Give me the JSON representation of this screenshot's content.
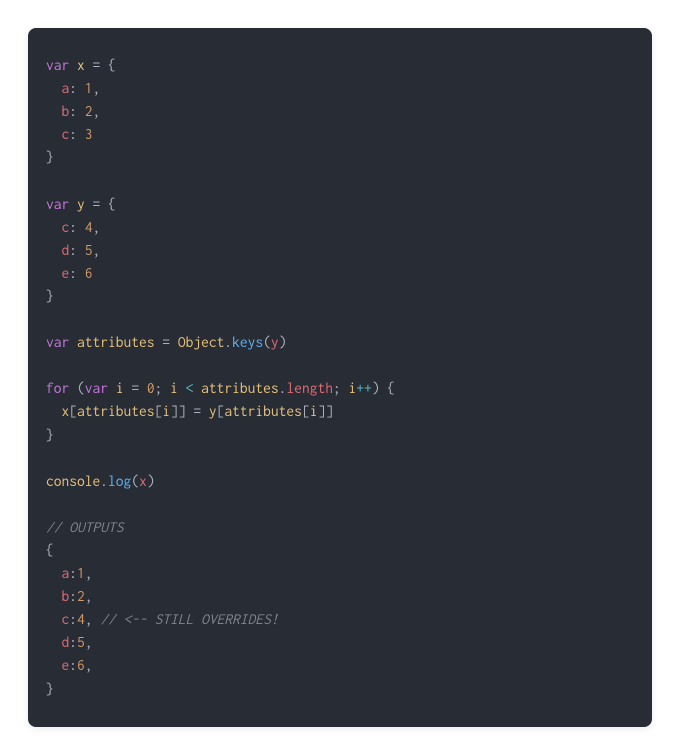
{
  "code": {
    "kw_var_1": "var",
    "x": "x",
    "eq": " = ",
    "brace_open": "{",
    "a": "a",
    "colon": ": ",
    "n1": "1",
    "comma": ",",
    "b": "b",
    "n2": "2",
    "c": "c",
    "n3": "3",
    "brace_close": "}",
    "y": "y",
    "n4": "4",
    "d": "d",
    "n5": "5",
    "e": "e",
    "n6": "6",
    "attributes": "attributes",
    "Object": "Object",
    "dot": ".",
    "keys": "keys",
    "paren_open": "(",
    "paren_close": ")",
    "for": "for",
    "i": "i",
    "n0": "0",
    "semi": "; ",
    "lt": " < ",
    "length": "length",
    "pp": "++",
    "bracket_open": "[",
    "bracket_close": "]",
    "console": "console",
    "log": "log",
    "cmt_outputs": "// OUTPUTS",
    "colon2": ":",
    "cmt_override": "// <-- STILL OVERRIDES!",
    "sp": " "
  }
}
